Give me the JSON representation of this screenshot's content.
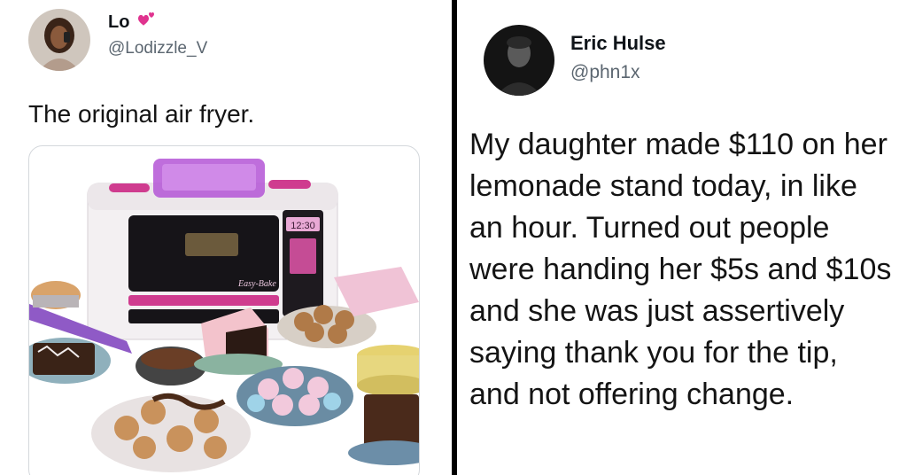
{
  "left_tweet": {
    "display_name": "Lo",
    "heart_icon": "pink-heart-icon",
    "handle": "@Lodizzle_V",
    "text": "The original air fryer.",
    "media": {
      "clock": "12:30",
      "brand": "Easy-Bake"
    }
  },
  "right_tweet": {
    "display_name": "Eric Hulse",
    "handle": "@phn1x",
    "text": "My daughter made $110 on her lemonade stand today, in like an hour. Turned out people were handing her $5s and $10s and she was just assertively saying thank you for the tip, and not offering change."
  },
  "colors": {
    "accent_pink": "#e0338f",
    "handle_gray": "#5b6670",
    "divider": "#000000"
  }
}
